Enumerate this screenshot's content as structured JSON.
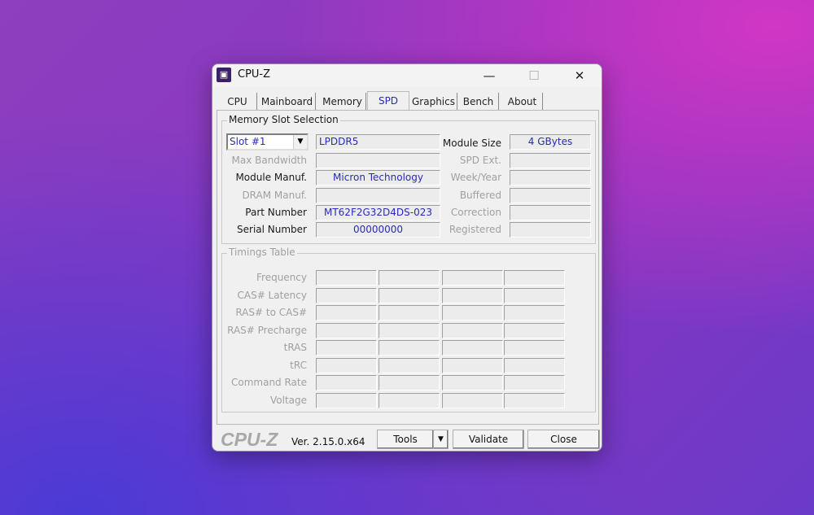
{
  "window": {
    "title": "CPU-Z",
    "minimize": "—",
    "maximize": "☐",
    "close": "✕",
    "icon": "cpu-chip-icon"
  },
  "tabs": [
    {
      "label": "CPU"
    },
    {
      "label": "Mainboard"
    },
    {
      "label": "Memory"
    },
    {
      "label": "SPD",
      "active": true
    },
    {
      "label": "Graphics"
    },
    {
      "label": "Bench"
    },
    {
      "label": "About"
    }
  ],
  "slot": {
    "group_label": "Memory Slot Selection",
    "selected": "Slot #1",
    "arrow": "▼",
    "type": "LPDDR5",
    "left_rows": [
      {
        "label": "Max Bandwidth",
        "value": "",
        "enabled": false
      },
      {
        "label": "Module Manuf.",
        "value": "Micron Technology",
        "enabled": true
      },
      {
        "label": "DRAM Manuf.",
        "value": "",
        "enabled": false
      },
      {
        "label": "Part Number",
        "value": "MT62F2G32D4DS-023",
        "enabled": true
      },
      {
        "label": "Serial Number",
        "value": "00000000",
        "enabled": true
      }
    ],
    "right_rows": [
      {
        "label": "Module Size",
        "value": "4 GBytes",
        "enabled": true
      },
      {
        "label": "SPD Ext.",
        "value": "",
        "enabled": false
      },
      {
        "label": "Week/Year",
        "value": "",
        "enabled": false
      },
      {
        "label": "Buffered",
        "value": "",
        "enabled": false
      },
      {
        "label": "Correction",
        "value": "",
        "enabled": false
      },
      {
        "label": "Registered",
        "value": "",
        "enabled": false
      }
    ]
  },
  "timings": {
    "group_label": "Timings Table",
    "rows": [
      "Frequency",
      "CAS# Latency",
      "RAS# to CAS#",
      "RAS# Precharge",
      "tRAS",
      "tRC",
      "Command Rate",
      "Voltage"
    ]
  },
  "footer": {
    "logo": "CPU-Z",
    "version": "Ver. 2.15.0.x64",
    "tools": "Tools",
    "tools_arrow": "▼",
    "validate": "Validate",
    "close": "Close"
  },
  "colors": {
    "value_text": "#2a2ab8",
    "disabled_text": "#a0a0a0"
  }
}
